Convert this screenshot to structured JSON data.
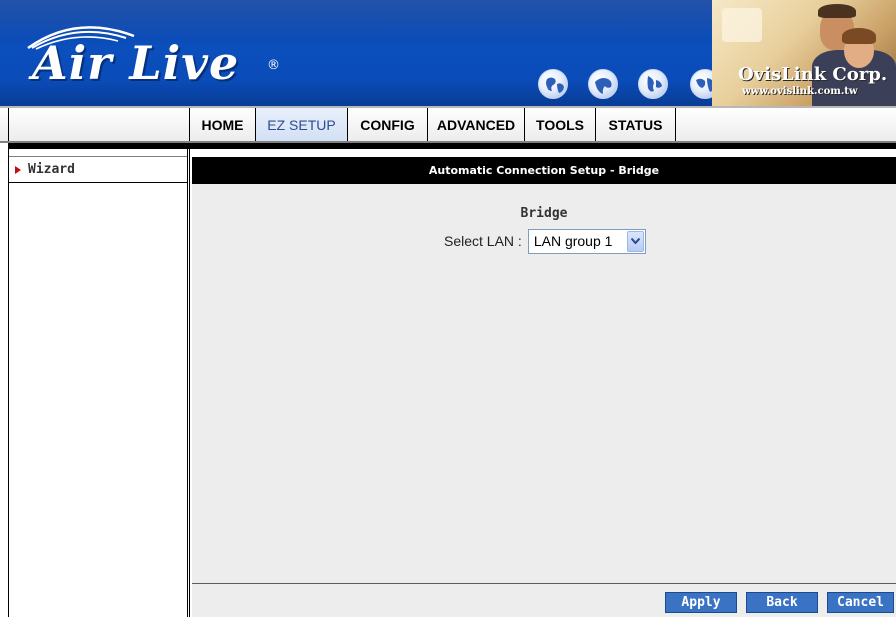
{
  "header": {
    "logo": "Air Live",
    "logo_reg": "®",
    "corp_name": "OvisLink Corp.",
    "corp_url": "www.ovislink.com.tw",
    "globe_icons": [
      "globe-icon",
      "globe-icon",
      "globe-icon",
      "globe-icon"
    ]
  },
  "nav": {
    "tabs": [
      {
        "label": "HOME",
        "active": false
      },
      {
        "label": "EZ SETUP",
        "active": true
      },
      {
        "label": "CONFIG",
        "active": false
      },
      {
        "label": "ADVANCED",
        "active": false
      },
      {
        "label": "TOOLS",
        "active": false
      },
      {
        "label": "STATUS",
        "active": false
      }
    ]
  },
  "sidebar": {
    "items": [
      {
        "label": "Wizard",
        "icon": "triangle-right-icon"
      }
    ]
  },
  "content": {
    "title": "Automatic Connection Setup - Bridge",
    "section_title": "Bridge",
    "select_lan": {
      "label": "Select LAN :",
      "value": "LAN group 1"
    }
  },
  "buttons": {
    "apply": "Apply",
    "back": "Back",
    "cancel": "Cancel"
  },
  "colors": {
    "header_blue": "#0b4fbd",
    "button_blue": "#3a72c4",
    "title_bar": "#000000",
    "content_bg": "#ededed",
    "active_tab": "#d3e0f5"
  }
}
